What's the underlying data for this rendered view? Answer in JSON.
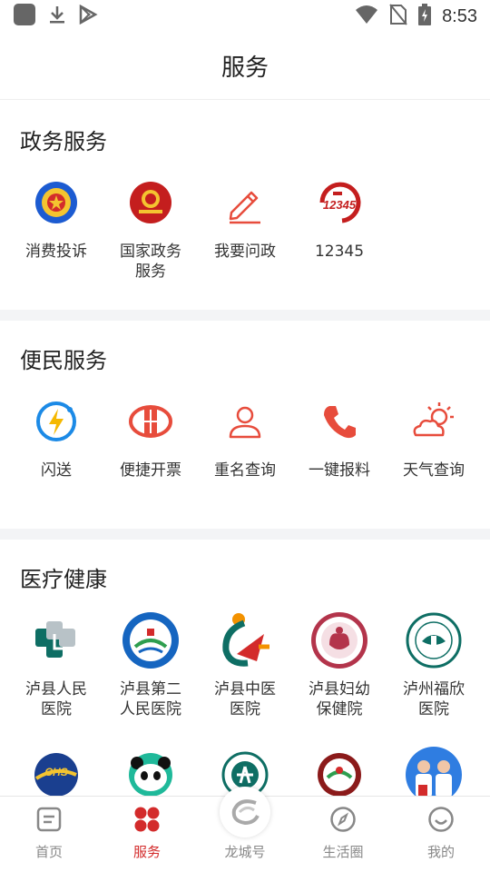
{
  "status_bar": {
    "time": "8:53",
    "left_icons": [
      "app-icon",
      "download-icon",
      "play-store-icon"
    ],
    "right_icons": [
      "wifi-icon",
      "no-sim-icon",
      "battery-charging-icon"
    ]
  },
  "header": {
    "title": "服务"
  },
  "sections": [
    {
      "title": "政务服务",
      "items": [
        {
          "label": "消费投诉",
          "icon": "consumer-complaint-icon"
        },
        {
          "label": "国家政务\n服务",
          "icon": "national-emblem-icon"
        },
        {
          "label": "我要问政",
          "icon": "pencil-icon"
        },
        {
          "label": "12345",
          "icon": "hotline-12345-icon"
        }
      ]
    },
    {
      "title": "便民服务",
      "items": [
        {
          "label": "闪送",
          "icon": "flash-delivery-icon"
        },
        {
          "label": "便捷开票",
          "icon": "invoice-icon"
        },
        {
          "label": "重名查询",
          "icon": "person-icon"
        },
        {
          "label": "一键报料",
          "icon": "phone-icon"
        },
        {
          "label": "天气查询",
          "icon": "weather-icon"
        }
      ]
    },
    {
      "title": "医疗健康",
      "items": [
        {
          "label": "泸县人民\n医院",
          "icon": "hospital-logo-1-icon"
        },
        {
          "label": "泸县第二\n人民医院",
          "icon": "hospital-logo-2-icon"
        },
        {
          "label": "泸县中医\n医院",
          "icon": "hospital-logo-3-icon"
        },
        {
          "label": "泸县妇幼\n保健院",
          "icon": "hospital-logo-4-icon"
        },
        {
          "label": "泸州福欣\n医院",
          "icon": "hospital-logo-5-icon"
        }
      ],
      "more_icons": [
        "chs-logo-icon",
        "panda-icon",
        "medical-logo-icon",
        "badge-logo-icon",
        "doctors-icon"
      ]
    }
  ],
  "tabbar": [
    {
      "label": "首页",
      "icon": "home-icon",
      "active": false
    },
    {
      "label": "服务",
      "icon": "grid-icon",
      "active": true
    },
    {
      "label": "龙城号",
      "icon": "dragon-city-icon",
      "active": false
    },
    {
      "label": "生活圈",
      "icon": "compass-icon",
      "active": false
    },
    {
      "label": "我的",
      "icon": "smile-icon",
      "active": false
    }
  ],
  "colors": {
    "accent": "#d32b2b",
    "blue": "#1c8ae6",
    "text": "#333333"
  }
}
